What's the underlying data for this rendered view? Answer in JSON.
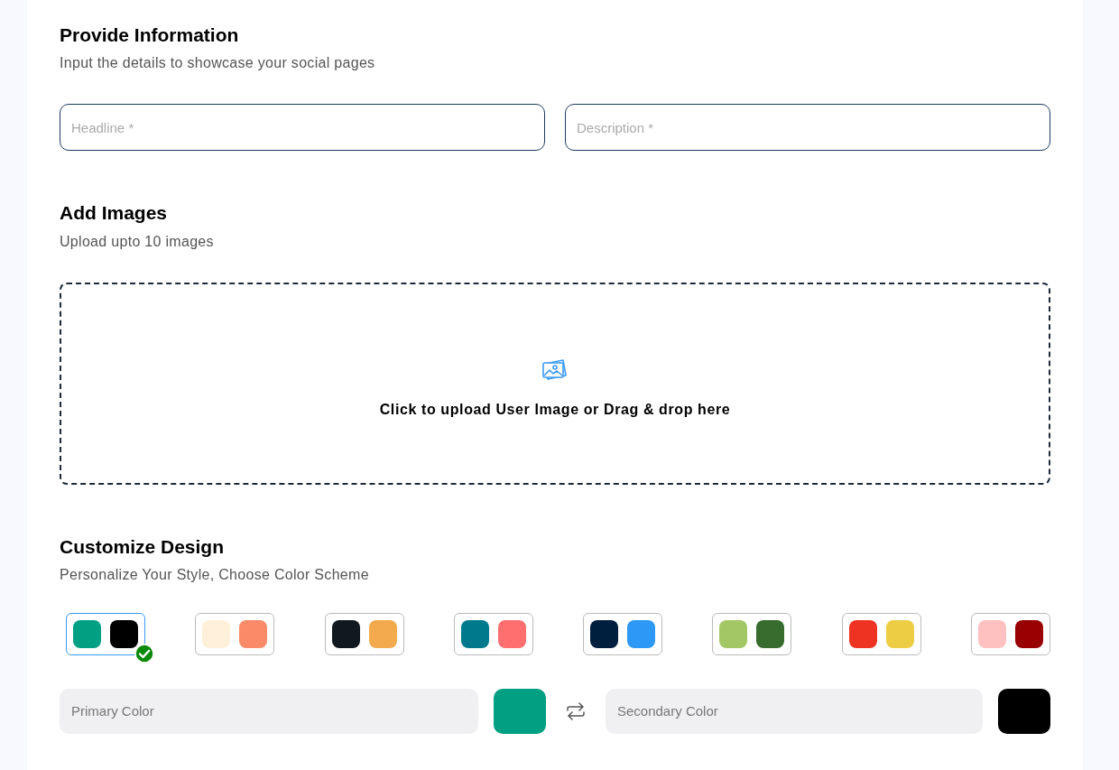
{
  "provide_information": {
    "title": "Provide Information",
    "subtitle": "Input the details to showcase your social pages",
    "fields": [
      {
        "placeholder": "Headline *"
      },
      {
        "placeholder": "Description *"
      }
    ]
  },
  "add_images": {
    "title": "Add Images",
    "subtitle": "Upload upto 10 images",
    "dropzone_text": "Click to upload User Image or Drag & drop here"
  },
  "customize_design": {
    "title": "Customize Design",
    "subtitle": "Personalize Your Style, Choose Color Scheme",
    "schemes": [
      {
        "selected": true,
        "swatches": [
          {
            "color": "#02a083"
          },
          {
            "color": "#000000"
          }
        ]
      },
      {
        "selected": false,
        "swatches": [
          {
            "color": "#fff1d9"
          },
          {
            "color": "#f98b69"
          }
        ]
      },
      {
        "selected": false,
        "swatches": [
          {
            "color": "#101820"
          },
          {
            "color": "#f2aa4d"
          }
        ]
      },
      {
        "selected": false,
        "swatches": [
          {
            "color": "#00798c"
          },
          {
            "color": "#ff6f6f"
          }
        ]
      },
      {
        "selected": false,
        "swatches": [
          {
            "color": "#001e3d"
          },
          {
            "color": "#2e98f6"
          }
        ]
      },
      {
        "selected": false,
        "swatches": [
          {
            "color": "#a4c765"
          },
          {
            "color": "#386b2e"
          }
        ]
      },
      {
        "selected": false,
        "swatches": [
          {
            "color": "#ef3323"
          },
          {
            "color": "#edcd44"
          }
        ]
      },
      {
        "selected": false,
        "swatches": [
          {
            "color": "#ffc1c0"
          },
          {
            "color": "#990001"
          }
        ]
      }
    ],
    "primary_color": {
      "placeholder": "Primary Color",
      "color": "#02a083"
    },
    "secondary_color": {
      "placeholder": "Secondary Color",
      "color": "#000000"
    }
  }
}
